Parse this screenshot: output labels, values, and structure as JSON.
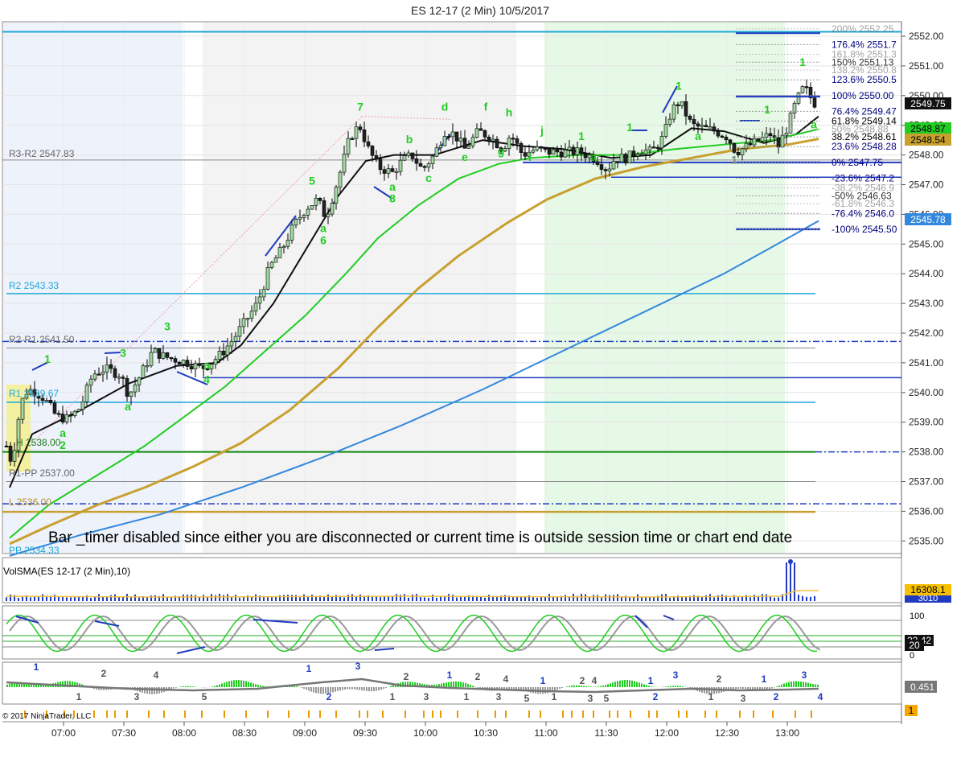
{
  "window": {
    "title": "ES 12-17 (2 Min)  10/5/2017"
  },
  "copyright": "© 2017 NinjaTrader, LLC",
  "notice": "Bar _timer disabled since either you are disconnected or current time is outside session time or chart end date",
  "price_axis": {
    "ticks": [
      "2552.00",
      "2551.00",
      "2550.00",
      "2549.00",
      "2548.00",
      "2547.00",
      "2546.00",
      "2545.00",
      "2544.00",
      "2543.00",
      "2542.00",
      "2541.00",
      "2540.00",
      "2539.00",
      "2538.00",
      "2537.00",
      "2536.00",
      "2535.00"
    ]
  },
  "time_axis": {
    "ticks": [
      "07:00",
      "07:30",
      "08:00",
      "08:30",
      "09:00",
      "09:30",
      "10:00",
      "10:30",
      "11:00",
      "11:30",
      "12:00",
      "12:30",
      "13:00"
    ]
  },
  "value_badges": {
    "last": "2549.75",
    "green": "2548.87",
    "gold": "2548.54",
    "blue": "2545.78",
    "volume": "16308.1",
    "volume_under": "3010",
    "stoch_value": "20",
    "stoch_under": "22.42",
    "osc_value": "0.451",
    "events_value": "1"
  },
  "pivot_labels": {
    "r3r2": "R3-R2 2547.83",
    "r2": "R2 2543.33",
    "r2r1": "R2-R1 2541.50",
    "r1": "R1 2539.67",
    "h": "H 2538.00",
    "r1pp": "R1-PP 2537.00",
    "l": "L 2536.00",
    "pp": "PP 2534.33"
  },
  "fib_labels": [
    {
      "level": 200.0,
      "text": "200%  2552.25",
      "color": "#555555",
      "light": true
    },
    {
      "level": 176.4,
      "text": "176.4%  2551.7",
      "color": "#000080",
      "light": false
    },
    {
      "level": 161.8,
      "text": "161.8%  2551.3",
      "color": "#555555",
      "light": true
    },
    {
      "level": 150.0,
      "text": "150%  2551.13",
      "color": "#333333",
      "light": false
    },
    {
      "level": 138.2,
      "text": "138.2%  2550.8",
      "color": "#555555",
      "light": true
    },
    {
      "level": 123.6,
      "text": "123.6%  2550.5",
      "color": "#000080",
      "light": false
    },
    {
      "level": 100.0,
      "text": "100%  2550.00",
      "color": "#000080",
      "light": false
    },
    {
      "level": 76.4,
      "text": "76.4%  2549.47",
      "color": "#000080",
      "light": false
    },
    {
      "level": 61.8,
      "text": "61.8%  2549.14",
      "color": "#000000",
      "light": false
    },
    {
      "level": 50.0,
      "text": "50%  2548.88",
      "color": "#555555",
      "light": true
    },
    {
      "level": 38.2,
      "text": "38.2%  2548.61",
      "color": "#000000",
      "light": false
    },
    {
      "level": 23.6,
      "text": "23.6%  2548.28",
      "color": "#000080",
      "light": false
    },
    {
      "level": 0.0,
      "text": "0%  2547.75",
      "color": "#000080",
      "light": false
    },
    {
      "level": -23.6,
      "text": "-23.6%  2547.2",
      "color": "#000080",
      "light": false
    },
    {
      "level": -38.2,
      "text": "-38.2%  2546.9",
      "color": "#555555",
      "light": true
    },
    {
      "level": -50.0,
      "text": "-50%  2546.63",
      "color": "#333333",
      "light": false
    },
    {
      "level": -61.8,
      "text": "-61.8%  2546.3",
      "color": "#555555",
      "light": true
    },
    {
      "level": -76.4,
      "text": "-76.4%  2546.0",
      "color": "#000080",
      "light": false
    },
    {
      "level": -100.0,
      "text": "-100%  2545.50",
      "color": "#000080",
      "light": false
    }
  ],
  "panels": {
    "volume_title": "VolSMA(ES 12-17 (2 Min),10)",
    "stoch_ticks": [
      "100",
      "0"
    ]
  },
  "wave_labels": [
    {
      "t": "1",
      "x": 59,
      "p": 2541.0
    },
    {
      "t": "a",
      "x": 78,
      "p": 2538.5
    },
    {
      "t": "2",
      "x": 78,
      "p": 2538.1
    },
    {
      "t": "3",
      "x": 153,
      "p": 2541.2
    },
    {
      "t": "a",
      "x": 159,
      "p": 2539.4
    },
    {
      "t": "3",
      "x": 208,
      "p": 2542.1
    },
    {
      "t": "a",
      "x": 257,
      "p": 2540.8
    },
    {
      "t": "4",
      "x": 257,
      "p": 2540.3
    },
    {
      "t": "5",
      "x": 388,
      "p": 2547.0
    },
    {
      "t": "a",
      "x": 402,
      "p": 2545.4
    },
    {
      "t": "6",
      "x": 402,
      "p": 2545.0
    },
    {
      "t": "7",
      "x": 448,
      "p": 2549.5
    },
    {
      "t": "a",
      "x": 488,
      "p": 2546.8
    },
    {
      "t": "8",
      "x": 488,
      "p": 2546.4
    },
    {
      "t": "b",
      "x": 509,
      "p": 2548.4
    },
    {
      "t": "c",
      "x": 533,
      "p": 2547.1
    },
    {
      "t": "d",
      "x": 553,
      "p": 2549.5
    },
    {
      "t": "e",
      "x": 578,
      "p": 2547.8
    },
    {
      "t": "f",
      "x": 604,
      "p": 2549.5
    },
    {
      "t": "g",
      "x": 623,
      "p": 2548.0
    },
    {
      "t": "h",
      "x": 633,
      "p": 2549.3
    },
    {
      "t": "i",
      "x": 659,
      "p": 2547.8
    },
    {
      "t": "j",
      "x": 674,
      "p": 2548.7
    },
    {
      "t": "1",
      "x": 723,
      "p": 2548.5
    },
    {
      "t": "a",
      "x": 738,
      "p": 2547.8
    },
    {
      "t": "1",
      "x": 783,
      "p": 2548.8
    },
    {
      "t": "1",
      "x": 844,
      "p": 2550.2
    },
    {
      "t": "a",
      "x": 868,
      "p": 2548.5
    },
    {
      "t": "1",
      "x": 954,
      "p": 2549.4
    },
    {
      "t": "1",
      "x": 998,
      "p": 2551.0
    },
    {
      "t": "a",
      "x": 1012,
      "p": 2548.9
    },
    {
      "t": "1",
      "x": 913,
      "p": 2547.7
    }
  ],
  "osc_labels": [
    {
      "t": "1",
      "x": 45,
      "y": 833,
      "c": "#1f3bc0"
    },
    {
      "t": "2",
      "x": 129,
      "y": 841,
      "c": "#555555"
    },
    {
      "t": "4",
      "x": 194,
      "y": 843,
      "c": "#555555"
    },
    {
      "t": "1",
      "x": 98,
      "y": 870,
      "c": "#555555"
    },
    {
      "t": "3",
      "x": 170,
      "y": 870,
      "c": "#555555"
    },
    {
      "t": "5",
      "x": 254,
      "y": 870,
      "c": "#555555"
    },
    {
      "t": "1",
      "x": 384,
      "y": 835,
      "c": "#1f3bc0"
    },
    {
      "t": "3",
      "x": 445,
      "y": 832,
      "c": "#1f3bc0"
    },
    {
      "t": "2",
      "x": 409,
      "y": 870,
      "c": "#1f3bc0"
    },
    {
      "t": "2",
      "x": 505,
      "y": 845,
      "c": "#555555"
    },
    {
      "t": "1",
      "x": 488,
      "y": 870,
      "c": "#555555"
    },
    {
      "t": "3",
      "x": 530,
      "y": 870,
      "c": "#555555"
    },
    {
      "t": "1",
      "x": 559,
      "y": 843,
      "c": "#1f3bc0"
    },
    {
      "t": "2",
      "x": 594,
      "y": 845,
      "c": "#555555"
    },
    {
      "t": "4",
      "x": 629,
      "y": 848,
      "c": "#555555"
    },
    {
      "t": "1",
      "x": 580,
      "y": 870,
      "c": "#555555"
    },
    {
      "t": "3",
      "x": 620,
      "y": 870,
      "c": "#555555"
    },
    {
      "t": "5",
      "x": 655,
      "y": 872,
      "c": "#555555"
    },
    {
      "t": "1",
      "x": 675,
      "y": 850,
      "c": "#1f3bc0"
    },
    {
      "t": "1",
      "x": 689,
      "y": 870,
      "c": "#555555"
    },
    {
      "t": "2",
      "x": 724,
      "y": 850,
      "c": "#555555"
    },
    {
      "t": "4",
      "x": 739,
      "y": 850,
      "c": "#555555"
    },
    {
      "t": "3",
      "x": 734,
      "y": 872,
      "c": "#555555"
    },
    {
      "t": "5",
      "x": 754,
      "y": 872,
      "c": "#555555"
    },
    {
      "t": "1",
      "x": 809,
      "y": 850,
      "c": "#1f3bc0"
    },
    {
      "t": "2",
      "x": 815,
      "y": 870,
      "c": "#1f3bc0"
    },
    {
      "t": "3",
      "x": 840,
      "y": 843,
      "c": "#1f3bc0"
    },
    {
      "t": "2",
      "x": 894,
      "y": 848,
      "c": "#555555"
    },
    {
      "t": "1",
      "x": 884,
      "y": 870,
      "c": "#555555"
    },
    {
      "t": "3",
      "x": 924,
      "y": 872,
      "c": "#555555"
    },
    {
      "t": "1",
      "x": 950,
      "y": 848,
      "c": "#1f3bc0"
    },
    {
      "t": "2",
      "x": 965,
      "y": 870,
      "c": "#1f3bc0"
    },
    {
      "t": "3",
      "x": 1000,
      "y": 843,
      "c": "#1f3bc0"
    },
    {
      "t": "4",
      "x": 1020,
      "y": 870,
      "c": "#1f3bc0"
    }
  ],
  "chart_data": {
    "type": "candlestick",
    "title": "ES 12-17 (2 Min)  10/5/2017",
    "ylim": [
      2534.8,
      2552.4
    ],
    "time_range": [
      "06:40",
      "13:18"
    ],
    "last_price": 2549.75,
    "price_path": [
      {
        "x": 8,
        "p": 2538.2
      },
      {
        "x": 15,
        "p": 2537.6
      },
      {
        "x": 22,
        "p": 2539.0
      },
      {
        "x": 30,
        "p": 2540.0
      },
      {
        "x": 40,
        "p": 2540.1
      },
      {
        "x": 55,
        "p": 2539.8
      },
      {
        "x": 70,
        "p": 2539.2
      },
      {
        "x": 85,
        "p": 2539.1
      },
      {
        "x": 100,
        "p": 2539.5
      },
      {
        "x": 115,
        "p": 2540.6
      },
      {
        "x": 130,
        "p": 2540.8
      },
      {
        "x": 150,
        "p": 2540.6
      },
      {
        "x": 160,
        "p": 2539.9
      },
      {
        "x": 175,
        "p": 2540.6
      },
      {
        "x": 190,
        "p": 2541.4
      },
      {
        "x": 205,
        "p": 2541.2
      },
      {
        "x": 220,
        "p": 2541.1
      },
      {
        "x": 235,
        "p": 2541.0
      },
      {
        "x": 250,
        "p": 2540.8
      },
      {
        "x": 262,
        "p": 2541.0
      },
      {
        "x": 275,
        "p": 2541.3
      },
      {
        "x": 290,
        "p": 2541.8
      },
      {
        "x": 305,
        "p": 2542.4
      },
      {
        "x": 320,
        "p": 2543.0
      },
      {
        "x": 335,
        "p": 2544.2
      },
      {
        "x": 350,
        "p": 2544.8
      },
      {
        "x": 365,
        "p": 2545.6
      },
      {
        "x": 380,
        "p": 2546.2
      },
      {
        "x": 395,
        "p": 2546.5
      },
      {
        "x": 405,
        "p": 2545.9
      },
      {
        "x": 415,
        "p": 2546.7
      },
      {
        "x": 425,
        "p": 2547.6
      },
      {
        "x": 435,
        "p": 2548.6
      },
      {
        "x": 447,
        "p": 2549.0
      },
      {
        "x": 458,
        "p": 2548.2
      },
      {
        "x": 470,
        "p": 2547.6
      },
      {
        "x": 488,
        "p": 2547.4
      },
      {
        "x": 500,
        "p": 2547.8
      },
      {
        "x": 512,
        "p": 2548.0
      },
      {
        "x": 525,
        "p": 2547.5
      },
      {
        "x": 540,
        "p": 2548.0
      },
      {
        "x": 553,
        "p": 2548.8
      },
      {
        "x": 565,
        "p": 2548.7
      },
      {
        "x": 578,
        "p": 2548.2
      },
      {
        "x": 595,
        "p": 2548.8
      },
      {
        "x": 610,
        "p": 2548.6
      },
      {
        "x": 625,
        "p": 2548.2
      },
      {
        "x": 635,
        "p": 2548.7
      },
      {
        "x": 650,
        "p": 2548.0
      },
      {
        "x": 665,
        "p": 2548.2
      },
      {
        "x": 680,
        "p": 2548.1
      },
      {
        "x": 700,
        "p": 2548.1
      },
      {
        "x": 720,
        "p": 2548.1
      },
      {
        "x": 740,
        "p": 2547.9
      },
      {
        "x": 755,
        "p": 2547.5
      },
      {
        "x": 765,
        "p": 2547.9
      },
      {
        "x": 780,
        "p": 2547.9
      },
      {
        "x": 795,
        "p": 2548.2
      },
      {
        "x": 810,
        "p": 2548.1
      },
      {
        "x": 825,
        "p": 2548.6
      },
      {
        "x": 835,
        "p": 2549.5
      },
      {
        "x": 845,
        "p": 2549.8
      },
      {
        "x": 860,
        "p": 2549.0
      },
      {
        "x": 875,
        "p": 2548.9
      },
      {
        "x": 890,
        "p": 2548.8
      },
      {
        "x": 905,
        "p": 2548.6
      },
      {
        "x": 915,
        "p": 2548.1
      },
      {
        "x": 930,
        "p": 2548.3
      },
      {
        "x": 945,
        "p": 2548.5
      },
      {
        "x": 958,
        "p": 2548.7
      },
      {
        "x": 968,
        "p": 2548.3
      },
      {
        "x": 980,
        "p": 2549.0
      },
      {
        "x": 990,
        "p": 2549.8
      },
      {
        "x": 1000,
        "p": 2550.3
      },
      {
        "x": 1012,
        "p": 2549.75
      }
    ],
    "series": [
      {
        "color": "#111111",
        "points": [
          [
            12,
            2536.8
          ],
          [
            40,
            2538.6
          ],
          [
            100,
            2539.4
          ],
          [
            160,
            2540.3
          ],
          [
            220,
            2540.9
          ],
          [
            270,
            2541.0
          ],
          [
            300,
            2541.6
          ],
          [
            340,
            2543.0
          ],
          [
            380,
            2544.8
          ],
          [
            420,
            2546.6
          ],
          [
            455,
            2547.8
          ],
          [
            490,
            2548.0
          ],
          [
            540,
            2548.0
          ],
          [
            600,
            2548.5
          ],
          [
            650,
            2548.3
          ],
          [
            700,
            2548.2
          ],
          [
            760,
            2547.9
          ],
          [
            810,
            2548.0
          ],
          [
            860,
            2548.9
          ],
          [
            900,
            2548.8
          ],
          [
            950,
            2548.4
          ],
          [
            990,
            2548.7
          ],
          [
            1018,
            2549.3
          ]
        ]
      },
      {
        "color": "#22cc22",
        "points": [
          [
            12,
            2535.1
          ],
          [
            60,
            2536.2
          ],
          [
            120,
            2537.2
          ],
          [
            180,
            2538.2
          ],
          [
            230,
            2539.2
          ],
          [
            280,
            2540.2
          ],
          [
            330,
            2541.4
          ],
          [
            380,
            2542.6
          ],
          [
            430,
            2544.0
          ],
          [
            470,
            2545.2
          ],
          [
            520,
            2546.3
          ],
          [
            570,
            2547.2
          ],
          [
            620,
            2547.7
          ],
          [
            660,
            2547.9
          ],
          [
            720,
            2548.0
          ],
          [
            780,
            2548.0
          ],
          [
            840,
            2548.2
          ],
          [
            900,
            2548.35
          ],
          [
            960,
            2548.5
          ],
          [
            1018,
            2548.87
          ]
        ]
      },
      {
        "color": "#c8a030",
        "points": [
          [
            12,
            2534.9
          ],
          [
            60,
            2535.5
          ],
          [
            120,
            2536.2
          ],
          [
            180,
            2536.8
          ],
          [
            240,
            2537.5
          ],
          [
            300,
            2538.3
          ],
          [
            360,
            2539.4
          ],
          [
            420,
            2540.8
          ],
          [
            470,
            2542.2
          ],
          [
            520,
            2543.5
          ],
          [
            570,
            2544.6
          ],
          [
            630,
            2545.7
          ],
          [
            680,
            2546.5
          ],
          [
            740,
            2547.2
          ],
          [
            800,
            2547.6
          ],
          [
            860,
            2547.9
          ],
          [
            920,
            2548.2
          ],
          [
            980,
            2548.35
          ],
          [
            1018,
            2548.54
          ]
        ]
      },
      {
        "color": "#3388dd",
        "points": [
          [
            12,
            2534.5
          ],
          [
            100,
            2535.2
          ],
          [
            200,
            2535.9
          ],
          [
            300,
            2536.8
          ],
          [
            400,
            2537.8
          ],
          [
            500,
            2538.9
          ],
          [
            600,
            2540.1
          ],
          [
            700,
            2541.4
          ],
          [
            800,
            2542.7
          ],
          [
            900,
            2544.0
          ],
          [
            960,
            2544.9
          ],
          [
            1018,
            2545.78
          ]
        ]
      }
    ],
    "pivots": [
      {
        "name": "R3-R2",
        "price": 2547.83
      },
      {
        "name": "R2",
        "price": 2543.33
      },
      {
        "name": "R2-R1",
        "price": 2541.5
      },
      {
        "name": "R1",
        "price": 2539.67
      },
      {
        "name": "H",
        "price": 2538.0
      },
      {
        "name": "R1-PP",
        "price": 2537.0
      },
      {
        "name": "L",
        "price": 2536.0
      },
      {
        "name": "PP",
        "price": 2534.33
      }
    ],
    "volume": {
      "last": 16308.1
    },
    "stochastic": {
      "ylim": [
        0,
        100
      ],
      "last": 20
    },
    "oscillator": {
      "last": 0.451
    }
  }
}
